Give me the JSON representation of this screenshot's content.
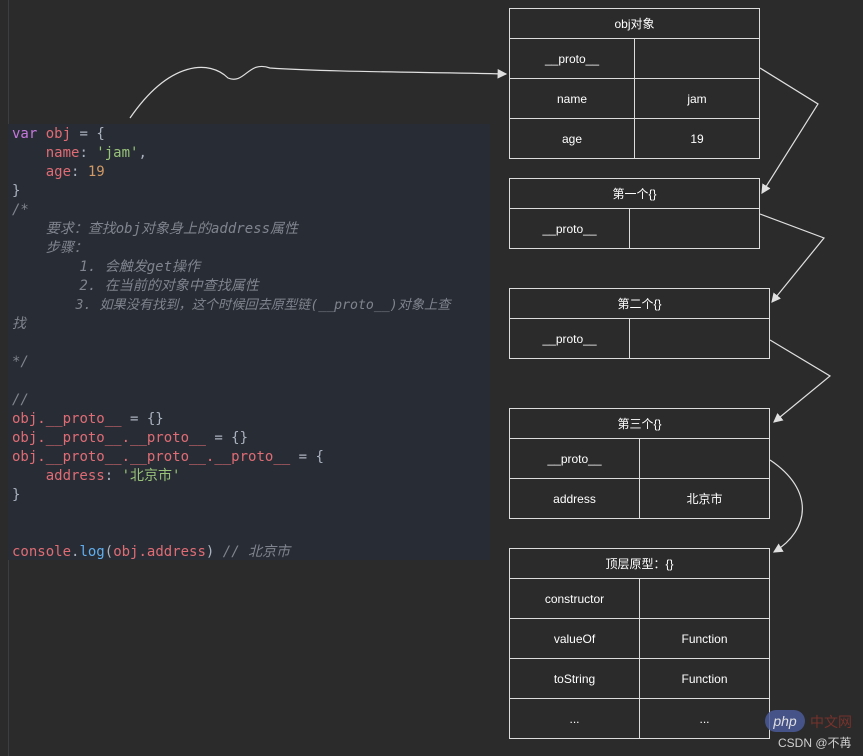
{
  "code": {
    "l1": {
      "kw": "var",
      "name": "obj",
      "rest": " = {"
    },
    "l2": {
      "key": "name",
      "colon": ": ",
      "val": "'jam'",
      "comma": ","
    },
    "l3": {
      "key": "age",
      "colon": ": ",
      "val": "19"
    },
    "l4": "}",
    "c1": "/*",
    "c2": "    要求：查找obj对象身上的address属性",
    "c3": "    步骤：",
    "c4": "        1. 会触发get操作",
    "c5": "        2. 在当前的对象中查找属性",
    "c6": "        3. 如果没有找到，这个时候回去原型链(__proto__)对象上查",
    "c7": "找",
    "c8": "*/",
    "c9": "//",
    "p1": {
      "obj": "obj",
      "a": ".__proto__",
      "rest": " = {}"
    },
    "p2": {
      "obj": "obj",
      "a": ".__proto__",
      "b": ".__proto__",
      "rest": " = {}"
    },
    "p3": {
      "obj": "obj",
      "a": ".__proto__",
      "b": ".__proto__",
      "c": ".__proto__",
      "rest": " = {"
    },
    "p4": {
      "key": "address",
      "colon": ": ",
      "val": "'北京市'"
    },
    "p5": "}",
    "log": {
      "obj": "console",
      "dot": ".",
      "fn": "log",
      "open": "(",
      "arg": "obj.address",
      "close": ")",
      "cmt": " // 北京市"
    }
  },
  "boxes": {
    "obj": {
      "title": "obj对象",
      "rows": [
        [
          "__proto__",
          ""
        ],
        [
          "name",
          "jam"
        ],
        [
          "age",
          "19"
        ]
      ]
    },
    "first": {
      "title": "第一个{}",
      "rows": [
        [
          "__proto__",
          ""
        ]
      ]
    },
    "second": {
      "title": "第二个{}",
      "rows": [
        [
          "__proto__",
          ""
        ]
      ]
    },
    "third": {
      "title": "第三个{}",
      "rows": [
        [
          "__proto__",
          ""
        ],
        [
          "address",
          "北京市"
        ]
      ]
    },
    "top": {
      "title": "顶层原型：{}",
      "rows": [
        [
          "constructor",
          ""
        ],
        [
          "valueOf",
          "Function"
        ],
        [
          "toString",
          "Function"
        ],
        [
          "...",
          "..."
        ]
      ]
    }
  },
  "watermark": {
    "php": "php",
    "cn": "中文网",
    "csdn": "CSDN @不苒"
  }
}
